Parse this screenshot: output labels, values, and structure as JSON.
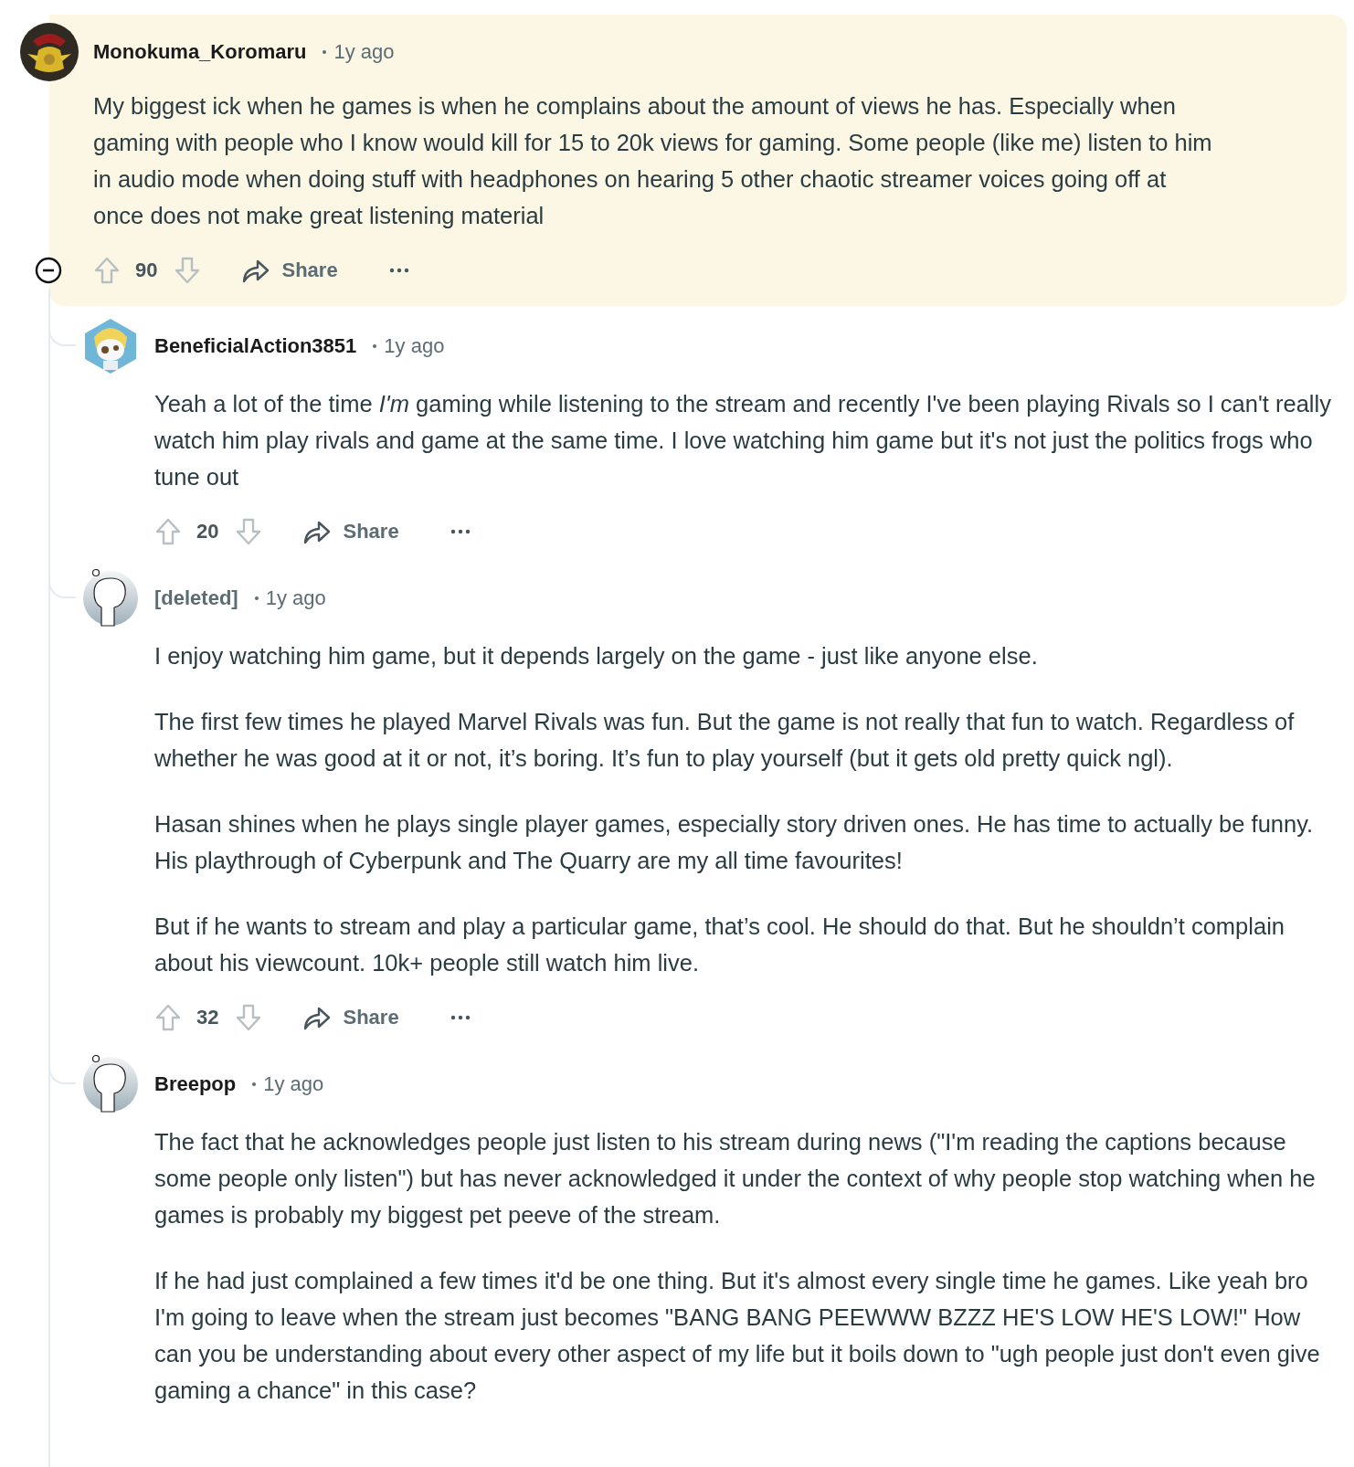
{
  "comments": [
    {
      "author": "Monokuma_Koromaru",
      "author_deleted": false,
      "time": "1y ago",
      "highlighted": true,
      "expanded": true,
      "paragraphs": [
        "My biggest ick when he games is when he complains about the amount of views he has. Especially when gaming with people who I know would kill for 15 to 20k views for gaming. Some people (like me) listen to him in audio mode when doing stuff with headphones on hearing 5 other chaotic streamer voices going off at once does not make great listening material"
      ],
      "score": "90",
      "share": "Share",
      "children": [
        {
          "author": "BeneficialAction3851",
          "author_deleted": false,
          "time": "1y ago",
          "paragraphs": [
            "Yeah a lot of the time *I'm* gaming while listening to the stream and recently I've been playing Rivals so I can't really watch him play rivals and game at the same time. I love watching him game but it's not just the politics frogs who tune out"
          ],
          "score": "20",
          "share": "Share"
        },
        {
          "author": "[deleted]",
          "author_deleted": true,
          "time": "1y ago",
          "paragraphs": [
            "I enjoy watching him game, but it depends largely on the game - just like anyone else.",
            "The first few times he played Marvel Rivals was fun. But the game is not really that fun to watch. Regardless of whether he was good at it or not, it’s boring. It’s fun to play yourself (but it gets old pretty quick ngl).",
            "Hasan shines when he plays single player games, especially story driven ones. He has time to actually be funny. His playthrough of Cyberpunk and The Quarry are my all time favourites!",
            "But if he wants to stream and play a particular game, that’s cool. He should do that. But he shouldn’t complain about his viewcount. 10k+ people still watch him live."
          ],
          "score": "32",
          "share": "Share"
        },
        {
          "author": "Breepop",
          "author_deleted": false,
          "time": "1y ago",
          "paragraphs": [
            "The fact that he acknowledges people just listen to his stream during news (\"I'm reading the captions because some people only listen\") but has never acknowledged it under the context of why people stop watching when he games is probably my biggest pet peeve of the stream.",
            "If he had just complained a few times it'd be one thing. But it's almost every single time he games. Like yeah bro I'm going to leave when the stream just becomes \"BANG BANG PEEWWW BZZZ HE'S LOW HE'S LOW!\" How can you be understanding about every other aspect of my life but it boils down to \"ugh people just don't even give gaming a chance\" in this case?"
          ]
        }
      ]
    }
  ]
}
